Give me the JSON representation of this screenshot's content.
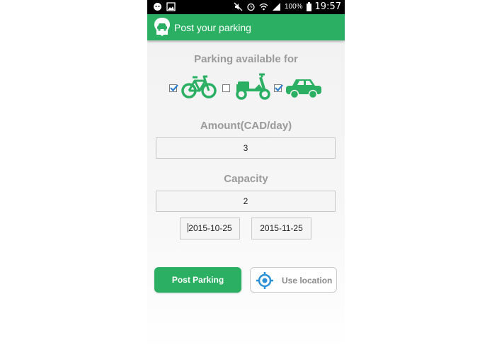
{
  "status_bar": {
    "battery": "100%",
    "time": "19:57"
  },
  "app_bar": {
    "title": "Post your parking"
  },
  "parking_section": {
    "heading": "Parking available for",
    "vehicles": [
      {
        "name": "bicycle",
        "icon": "bicycle-icon",
        "checked": true
      },
      {
        "name": "scooter",
        "icon": "scooter-icon",
        "checked": false
      },
      {
        "name": "car",
        "icon": "car-icon",
        "checked": true
      }
    ]
  },
  "amount": {
    "label": "Amount(CAD/day)",
    "value": "3"
  },
  "capacity": {
    "label": "Capacity",
    "value": "2"
  },
  "dates": {
    "start": "2015-10-25",
    "end": "2015-11-25"
  },
  "buttons": {
    "post_label": "Post Parking",
    "location_label": "Use location"
  },
  "colors": {
    "accent": "#2bb063",
    "location_icon": "#2d8fd5",
    "checkbox_check": "#2d7fd0"
  }
}
